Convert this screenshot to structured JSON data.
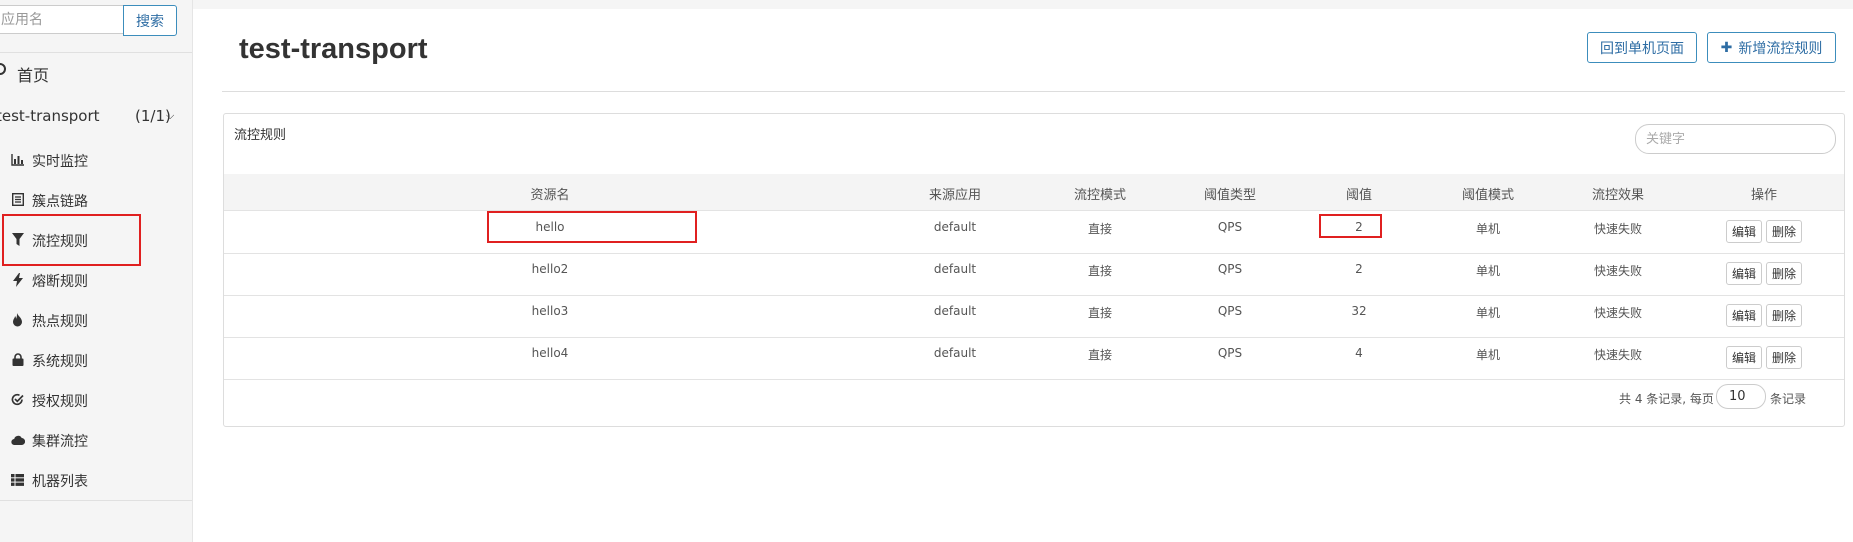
{
  "sidebar": {
    "search": {
      "placeholder": "应用名",
      "button_label": "搜索"
    },
    "home_label": "首页",
    "app": {
      "name": "test-transport",
      "count": "(1/1)"
    },
    "items": [
      {
        "label": "实时监控",
        "icon": "bar-chart-icon"
      },
      {
        "label": "簇点链路",
        "icon": "list-icon"
      },
      {
        "label": "流控规则",
        "icon": "filter-icon",
        "highlighted": true
      },
      {
        "label": "熔断规则",
        "icon": "bolt-icon"
      },
      {
        "label": "热点规则",
        "icon": "fire-icon"
      },
      {
        "label": "系统规则",
        "icon": "lock-icon"
      },
      {
        "label": "授权规则",
        "icon": "check-circle-icon"
      },
      {
        "label": "集群流控",
        "icon": "cloud-icon"
      },
      {
        "label": "机器列表",
        "icon": "table-list-icon"
      }
    ]
  },
  "header": {
    "title": "test-transport",
    "back_button": "回到单机页面",
    "add_button": "新增流控规则"
  },
  "panel": {
    "title": "流控规则",
    "keyword_placeholder": "关键字",
    "columns": [
      "资源名",
      "来源应用",
      "流控模式",
      "阈值类型",
      "阈值",
      "阈值模式",
      "流控效果",
      "操作"
    ],
    "rows": [
      {
        "resource": "hello",
        "origin": "default",
        "mode": "直接",
        "grade": "QPS",
        "count": "2",
        "cluster_mode": "单机",
        "effect": "快速失败"
      },
      {
        "resource": "hello2",
        "origin": "default",
        "mode": "直接",
        "grade": "QPS",
        "count": "2",
        "cluster_mode": "单机",
        "effect": "快速失败"
      },
      {
        "resource": "hello3",
        "origin": "default",
        "mode": "直接",
        "grade": "QPS",
        "count": "32",
        "cluster_mode": "单机",
        "effect": "快速失败"
      },
      {
        "resource": "hello4",
        "origin": "default",
        "mode": "直接",
        "grade": "QPS",
        "count": "4",
        "cluster_mode": "单机",
        "effect": "快速失败"
      }
    ],
    "edit_label": "编辑",
    "delete_label": "删除",
    "pagination": {
      "prefix": "共 4 条记录, 每页",
      "page_size": "10",
      "suffix": "条记录"
    }
  },
  "colors": {
    "accent": "#3c8dbc",
    "highlight": "#e02020"
  }
}
